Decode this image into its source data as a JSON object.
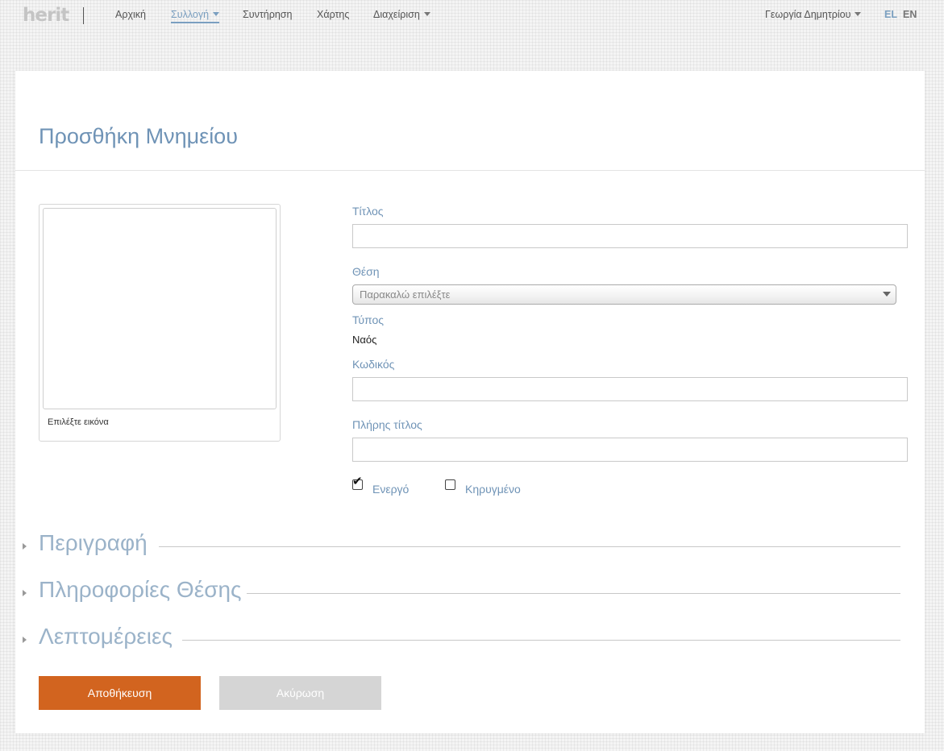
{
  "nav": {
    "logo": "herit",
    "items": [
      {
        "label": "Αρχική",
        "active": false,
        "dropdown": false
      },
      {
        "label": "Συλλογή",
        "active": true,
        "dropdown": true
      },
      {
        "label": "Συντήρηση",
        "active": false,
        "dropdown": false
      },
      {
        "label": "Χάρτης",
        "active": false,
        "dropdown": false
      },
      {
        "label": "Διαχείριση",
        "active": false,
        "dropdown": true
      }
    ],
    "user": "Γεωργία Δημητρίου",
    "languages": [
      {
        "label": "EL",
        "active": true
      },
      {
        "label": "EN",
        "active": false
      }
    ]
  },
  "page": {
    "title": "Προσθήκη Μνημείου"
  },
  "image_panel": {
    "caption": "Επιλέξτε εικόνα"
  },
  "form": {
    "title_label": "Τίτλος",
    "title_value": "",
    "position_label": "Θέση",
    "position_placeholder": "Παρακαλώ επιλέξτε",
    "type_label": "Τύπος",
    "type_value": "Ναός",
    "code_label": "Κωδικός",
    "code_value": "",
    "full_title_label": "Πλήρης τίτλος",
    "full_title_value": "",
    "active_label": "Ενεργό",
    "active_checked": true,
    "declared_label": "Κηρυγμένο",
    "declared_checked": false
  },
  "sections": [
    {
      "title": "Περιγραφή"
    },
    {
      "title": "Πληροφορίες Θέσης"
    },
    {
      "title": "Λεπτομέρειες"
    }
  ],
  "actions": {
    "save_label": "Αποθήκευση",
    "cancel_label": "Ακύρωση"
  },
  "colors": {
    "accent": "#6f93b6",
    "primary_button": "#d2641f",
    "secondary_button": "#d5d5d5"
  }
}
